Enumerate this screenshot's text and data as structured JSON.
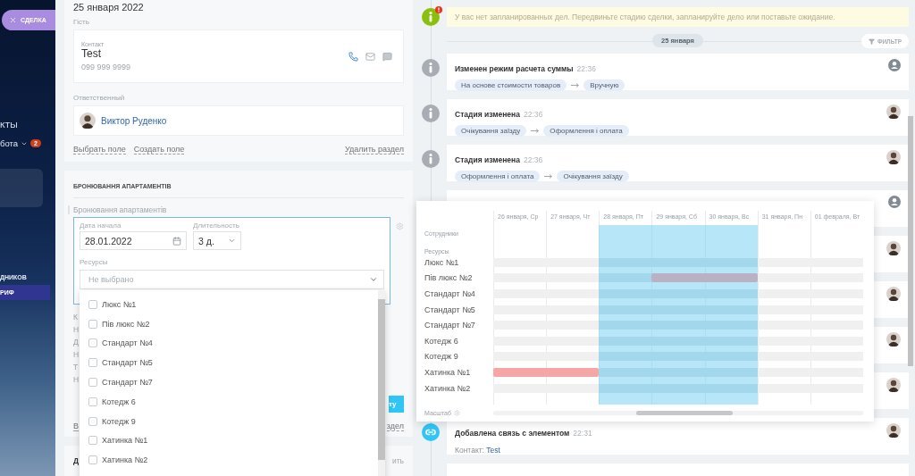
{
  "sidebar": {
    "deal_tab": "СДЕЛКА",
    "items": [
      {
        "kind": "link",
        "label": "КТЫ"
      },
      {
        "kind": "menu",
        "label": "бота",
        "badge": "2"
      },
      {
        "kind": "panel"
      },
      {
        "kind": "caption",
        "label": "ДНИКОВ"
      },
      {
        "kind": "band",
        "label": "РИФ"
      }
    ]
  },
  "details": {
    "date": "25 января 2022",
    "guest_label": "Гість",
    "contact_label": "Контакт",
    "contact_name": "Test",
    "contact_phone": "099 999 9999",
    "responsible_label": "Ответственный",
    "responsible_name": "Виктор Руденко",
    "links": [
      "Выбрать поле",
      "Создать поле"
    ],
    "delete_link": "Удалить раздел"
  },
  "booking": {
    "title": "БРОНЮВАННЯ АПАРТАМЕНТІВ",
    "field_label": "Бронювання апартаментів",
    "start_label": "Дата начала",
    "start_value": "28.01.2022",
    "duration_label": "Длительность",
    "duration_value": "3 д.",
    "resources_label": "Ресурсы",
    "resources_placeholder": "Не выбрано",
    "options": [
      {
        "label": "Люкс №1",
        "checked": false
      },
      {
        "label": "Пів люкс №2",
        "checked": false
      },
      {
        "label": "Стандарт №4",
        "checked": false
      },
      {
        "label": "Стандарт №5",
        "checked": false
      },
      {
        "label": "Стандарт №7",
        "checked": false
      },
      {
        "label": "Котедж 6",
        "checked": false
      },
      {
        "label": "Котедж 9",
        "checked": false
      },
      {
        "label": "Хатинка №1",
        "checked": false
      },
      {
        "label": "Хатинка №2",
        "checked": false
      }
    ],
    "covered_fields": [
      [
        "К",
        "Н"
      ],
      [
        "Д",
        "Н"
      ],
      [
        "Т",
        "Н"
      ]
    ],
    "button_fragment": "ту",
    "link_fragment": "В",
    "delete_fragment": "здел"
  },
  "next_section": {
    "title_fragment": "Д",
    "link_fragment": "ить"
  },
  "timeline": {
    "notice": "У вас нет запланированных дел. Передвиньте стадию сделки, запланируйте дело или поставьте ожидание.",
    "date": "25 января",
    "filter": "ФИЛЬТР",
    "events": [
      {
        "kind": "change",
        "title": "Изменен режим расчета суммы",
        "time": "22:36",
        "from": "На основе стоимости товаров",
        "to": "Вручную",
        "author": {
          "kind": "system"
        }
      },
      {
        "kind": "change",
        "title": "Стадия изменена",
        "time": "22:36",
        "from": "Очікування заїзду",
        "to": "Оформлення і оплата",
        "author": {
          "kind": "user"
        }
      },
      {
        "kind": "change",
        "title": "Стадия изменена",
        "time": "22:36",
        "from": "Оформлення і оплата",
        "to": "Очікування заїзду",
        "author": {
          "kind": "user"
        }
      },
      {
        "kind": "covered",
        "author": {
          "kind": "system"
        }
      },
      {
        "kind": "covered",
        "author": {
          "kind": "user"
        }
      },
      {
        "kind": "covered",
        "author": {
          "kind": "user"
        }
      },
      {
        "kind": "covered",
        "author": {
          "kind": "user"
        }
      },
      {
        "kind": "covered",
        "author": {
          "kind": "user"
        }
      },
      {
        "kind": "link",
        "title": "Добавлена связь с элементом",
        "time": "22:31",
        "contact_label": "Контакт:",
        "contact": "Test",
        "author": {
          "kind": "user"
        }
      },
      {
        "kind": "covered"
      }
    ]
  },
  "calendar": {
    "days": [
      {
        "label": "26 января, Ср",
        "selected": false
      },
      {
        "label": "27 января, Чт",
        "selected": false
      },
      {
        "label": "28 января, Пт",
        "selected": true
      },
      {
        "label": "29 января, Сб",
        "selected": true
      },
      {
        "label": "30 января, Вс",
        "selected": true
      },
      {
        "label": "31 января, Пн",
        "selected": false
      },
      {
        "label": "01 февраля, Вт",
        "selected": false
      }
    ],
    "employees_label": "Сотрудники",
    "resources_label": "Ресурсы",
    "scale_label": "Масштаб",
    "rows": [
      {
        "name": "Люкс №1",
        "booked": [
          false,
          false,
          false,
          false,
          false,
          false,
          false
        ]
      },
      {
        "name": "Пів люкс №2",
        "color": "#b9b1c4",
        "booked": [
          false,
          false,
          false,
          true,
          true,
          false,
          false
        ]
      },
      {
        "name": "Стандарт №4",
        "booked": [
          false,
          false,
          false,
          false,
          false,
          false,
          false
        ]
      },
      {
        "name": "Стандарт №5",
        "booked": [
          false,
          false,
          false,
          false,
          false,
          false,
          false
        ]
      },
      {
        "name": "Стандарт №7",
        "booked": [
          false,
          false,
          false,
          false,
          false,
          false,
          false
        ]
      },
      {
        "name": "Котедж 6",
        "booked": [
          false,
          false,
          false,
          false,
          false,
          false,
          false
        ]
      },
      {
        "name": "Котедж 9",
        "booked": [
          false,
          false,
          false,
          false,
          false,
          false,
          false
        ]
      },
      {
        "name": "Хатинка №1",
        "color": "#f6a6a4",
        "booked": [
          true,
          true,
          false,
          false,
          false,
          false,
          false
        ]
      },
      {
        "name": "Хатинка №2",
        "booked": [
          false,
          false,
          false,
          false,
          false,
          false,
          false
        ]
      }
    ]
  }
}
